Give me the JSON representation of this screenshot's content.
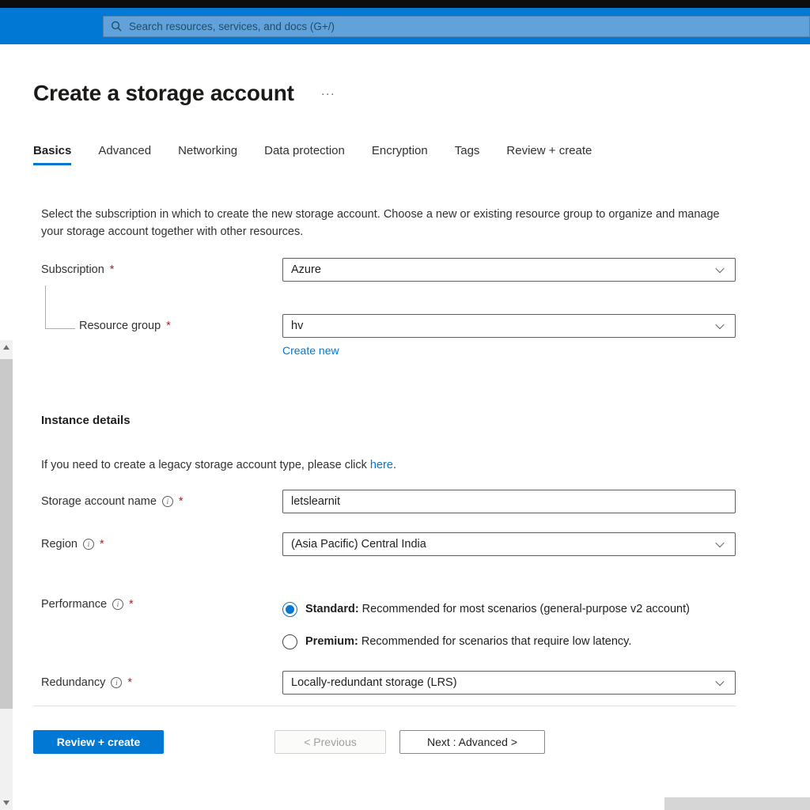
{
  "header": {
    "search": {
      "placeholder": "Search resources, services, and docs (G+/)"
    }
  },
  "page": {
    "title": "Create a storage account",
    "more_label": "···"
  },
  "tabs": {
    "active": "Basics",
    "items": [
      {
        "label": "Basics"
      },
      {
        "label": "Advanced"
      },
      {
        "label": "Networking"
      },
      {
        "label": "Data protection"
      },
      {
        "label": "Encryption"
      },
      {
        "label": "Tags"
      },
      {
        "label": "Review + create"
      }
    ]
  },
  "intro": {
    "text": "Select the subscription in which to create the new storage account. Choose a new or existing resource group to organize and manage your storage account together with other resources."
  },
  "form": {
    "required_marker": "*",
    "subscription": {
      "label": "Subscription",
      "value": "Azure"
    },
    "resource_group": {
      "label": "Resource group",
      "value": "hv",
      "create_new_label": "Create new"
    },
    "instance_details_heading": "Instance details",
    "legacy": {
      "before": "If you need to create a legacy storage account type, please click ",
      "link": "here",
      "after": "."
    },
    "storage_account_name": {
      "label": "Storage account name",
      "value": "letslearnit"
    },
    "region": {
      "label": "Region",
      "value": "(Asia Pacific) Central India"
    },
    "performance": {
      "label": "Performance",
      "options": [
        {
          "name": "Standard:",
          "description": "Recommended for most scenarios (general-purpose v2 account)",
          "selected": true
        },
        {
          "name": "Premium:",
          "description": "Recommended for scenarios that require low latency.",
          "selected": false
        }
      ]
    },
    "redundancy": {
      "label": "Redundancy",
      "value": "Locally-redundant storage (LRS)"
    }
  },
  "footer": {
    "review_create_label": "Review + create",
    "previous_label": "< Previous",
    "next_label": "Next : Advanced >"
  },
  "icons": {
    "info": "i"
  },
  "colors": {
    "accent": "#0078d4",
    "header_bg": "#0078d4",
    "link": "#0078d4",
    "required": "#a4262c"
  }
}
